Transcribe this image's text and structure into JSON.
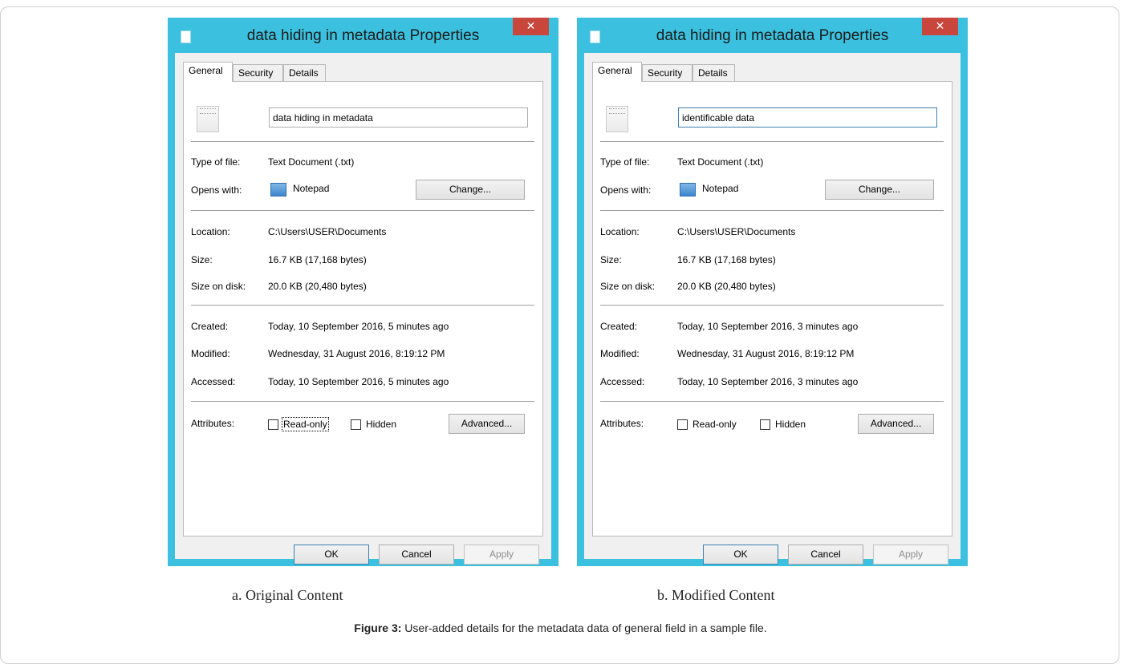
{
  "dialogs": [
    {
      "title": "data hiding in metadata Properties",
      "close": "✕",
      "tabs": [
        "General",
        "Security",
        "Details"
      ],
      "name_value": "data hiding in metadata",
      "type_label": "Type of file:",
      "type_value": "Text Document (.txt)",
      "opens_label": "Opens with:",
      "opens_value": "Notepad",
      "change_button": "Change...",
      "location_label": "Location:",
      "location_value": "C:\\Users\\USER\\Documents",
      "size_label": "Size:",
      "size_value": "16.7 KB (17,168 bytes)",
      "size_disk_label": "Size on disk:",
      "size_disk_value": "20.0 KB (20,480 bytes)",
      "created_label": "Created:",
      "created_value": "Today, 10 September 2016, 5 minutes ago",
      "modified_label": "Modified:",
      "modified_value": "Wednesday, 31 August 2016, 8:19:12 PM",
      "accessed_label": "Accessed:",
      "accessed_value": "Today, 10 September 2016, 5 minutes ago",
      "attributes_label": "Attributes:",
      "readonly_label": "Read-only",
      "hidden_label": "Hidden",
      "advanced_button": "Advanced...",
      "ok_button": "OK",
      "cancel_button": "Cancel",
      "apply_button": "Apply"
    },
    {
      "title": "data hiding in metadata Properties",
      "close": "✕",
      "tabs": [
        "General",
        "Security",
        "Details"
      ],
      "name_value": "identificable data",
      "type_label": "Type of file:",
      "type_value": "Text Document (.txt)",
      "opens_label": "Opens with:",
      "opens_value": "Notepad",
      "change_button": "Change...",
      "location_label": "Location:",
      "location_value": "C:\\Users\\USER\\Documents",
      "size_label": "Size:",
      "size_value": "16.7 KB (17,168 bytes)",
      "size_disk_label": "Size on disk:",
      "size_disk_value": "20.0 KB (20,480 bytes)",
      "created_label": "Created:",
      "created_value": "Today, 10 September 2016, 3 minutes ago",
      "modified_label": "Modified:",
      "modified_value": "Wednesday, 31 August 2016, 8:19:12 PM",
      "accessed_label": "Accessed:",
      "accessed_value": "Today, 10 September 2016, 3 minutes ago",
      "attributes_label": "Attributes:",
      "readonly_label": "Read-only",
      "hidden_label": "Hidden",
      "advanced_button": "Advanced...",
      "ok_button": "OK",
      "cancel_button": "Cancel",
      "apply_button": "Apply"
    }
  ],
  "captions": {
    "a": "a. Original Content",
    "b": "b. Modified Content",
    "figure_label": "Figure 3:",
    "figure_text": " User-added details for the metadata data of general field in a sample file."
  },
  "colors": {
    "window_frame": "#3bc1df",
    "close_button": "#c9463d",
    "default_button_border": "#3c7fb1"
  },
  "icons": {
    "title": "document-icon",
    "file": "text-file-icon",
    "app": "notepad-icon"
  }
}
